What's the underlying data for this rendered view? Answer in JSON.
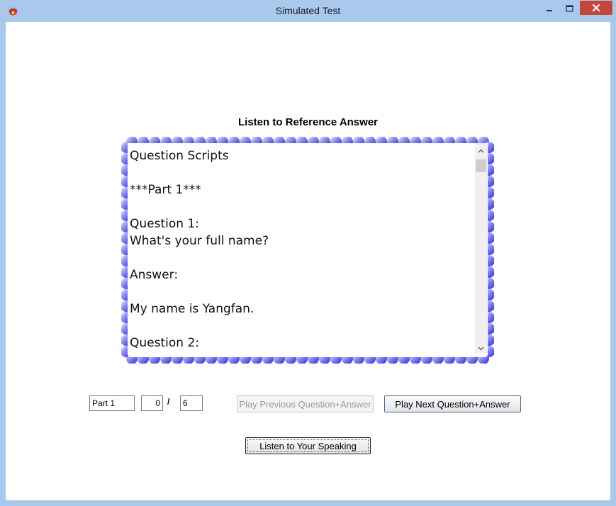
{
  "window": {
    "title": "Simulated Test",
    "app_icon": "strawberry-icon",
    "titlebar_color": "#a8c8ee",
    "close_color": "#c7463c"
  },
  "main": {
    "heading": "Listen to Reference Answer",
    "script_text": "Question Scripts\n\n***Part 1***\n\nQuestion 1:\nWhat's your full name?\n\nAnswer:\n\nMy name is Yangfan.\n\nQuestion 2:",
    "frame_color": "#3c3cf0"
  },
  "navigation": {
    "part_value": "Part 1",
    "current_value": "0",
    "separator": "/",
    "total_value": "6",
    "prev_button": "Play Previous Question+Answer",
    "next_button": "Play Next Question+Answer",
    "speaking_button": "Listen to Your Speaking"
  }
}
